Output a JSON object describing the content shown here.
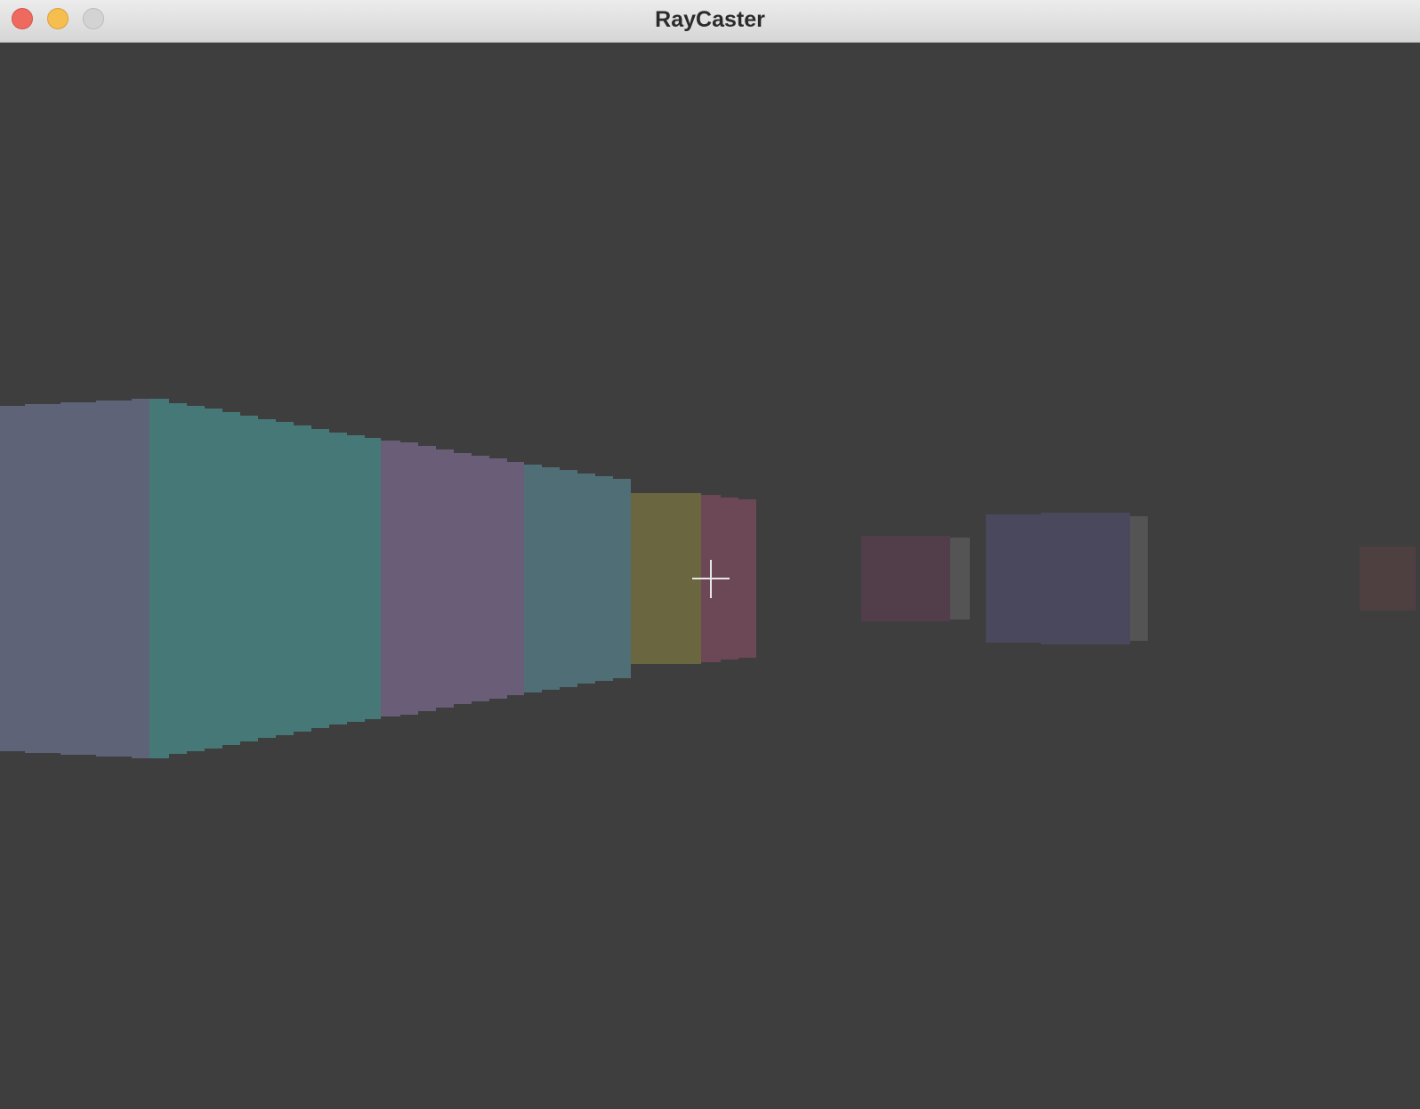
{
  "window": {
    "title": "RayCaster",
    "controls": [
      "close",
      "minimize",
      "zoom"
    ]
  },
  "scene": {
    "background_color": "#3e3e3e",
    "crosshair_color": "#e6e6e6",
    "crosshair_icon": "crosshair-icon",
    "wall_colors": {
      "slate": "#5e6377",
      "teal": "#467877",
      "purple": "#6a5d77",
      "steel-teal": "#4f6e75",
      "olive": "#6a6640",
      "rose": "#6c4756",
      "far-rose": "#523e4b",
      "grey-side": "#545454",
      "indigo": "#4a485d",
      "dark-red": "#4e3f41"
    }
  }
}
